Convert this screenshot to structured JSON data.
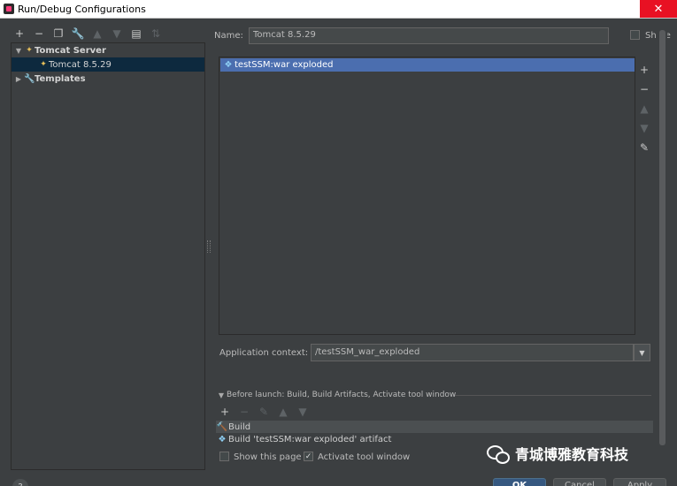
{
  "window": {
    "title": "Run/Debug Configurations",
    "close_icon": "close-icon",
    "close_glyph": "✕"
  },
  "left_toolbar": {
    "icons": [
      "add-icon",
      "remove-icon",
      "copy-icon",
      "wrench-icon",
      "move-up-icon",
      "move-down-icon",
      "folder-icon",
      "sort-icon"
    ],
    "glyphs": [
      "+",
      "−",
      "❐",
      "🔧",
      "▲",
      "▼",
      "▤",
      "⇅"
    ]
  },
  "tree": {
    "group_label": "Tomcat Server",
    "child_label": "Tomcat 8.5.29",
    "templates_label": "Templates",
    "expanded_glyph": "▼",
    "collapsed_glyph": "▶",
    "tomcat_glyph": "✦",
    "wrench_glyph": "🔧"
  },
  "form": {
    "name_label": "Name:",
    "name_value": "Tomcat 8.5.29",
    "share_label": "Share"
  },
  "deployment": {
    "items": [
      "testSSM:war exploded"
    ],
    "artifact_glyph": "❖",
    "tool_icons": [
      "add-icon",
      "remove-icon",
      "move-up-icon",
      "move-down-icon",
      "edit-icon"
    ],
    "tool_glyphs": [
      "+",
      "−",
      "▲",
      "▼",
      "✎"
    ]
  },
  "context": {
    "label": "Application context:",
    "value": "/testSSM_war_exploded",
    "dropdown_glyph": "▼"
  },
  "before_launch": {
    "header": "Before launch: Build, Build Artifacts, Activate tool window",
    "toolbar_glyphs": [
      "+",
      "−",
      "✎",
      "▲",
      "▼"
    ],
    "items": [
      "Build",
      "Build 'testSSM:war exploded' artifact"
    ],
    "build_glyph": "🔨",
    "artifact_glyph": "❖",
    "show_page_label": "Show this page",
    "activate_label": "Activate tool window",
    "check_glyph": "✓"
  },
  "watermark": {
    "text": "青城博雅教育科技"
  },
  "buttons": {
    "help": "?",
    "ok": "OK",
    "cancel": "Cancel",
    "apply": "Apply"
  }
}
